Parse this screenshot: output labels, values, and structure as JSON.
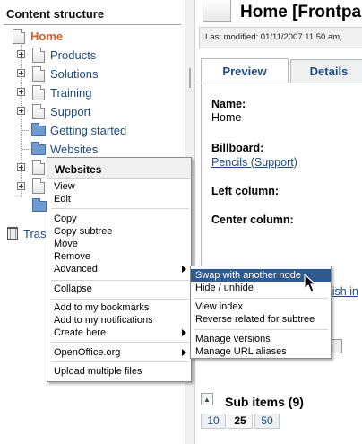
{
  "left_panel": {
    "title": "Content structure",
    "tree": [
      {
        "label": "Home",
        "kind": "page",
        "expandable": false,
        "root": true
      },
      {
        "label": "Products",
        "kind": "page",
        "expandable": true
      },
      {
        "label": "Solutions",
        "kind": "page",
        "expandable": true
      },
      {
        "label": "Training",
        "kind": "page",
        "expandable": true
      },
      {
        "label": "Support",
        "kind": "page",
        "expandable": true
      },
      {
        "label": "Getting started",
        "kind": "folder",
        "expandable": false
      },
      {
        "label": "Websites",
        "kind": "folder",
        "expandable": false
      }
    ],
    "trash_label": "Tras"
  },
  "right_panel": {
    "node_title": "Home [Frontpag",
    "last_modified": "Last modified: 01/11/2007 11:50 am,",
    "tabs": [
      {
        "label": "Preview",
        "active": true
      },
      {
        "label": "Details",
        "active": false
      }
    ],
    "fields": {
      "name_label": "Name:",
      "name_value": "Home",
      "billboard_label": "Billboard:",
      "billboard_value": "Pencils (Support)",
      "left_column_label": "Left column:",
      "center_column_label": "Center column:"
    },
    "partial_link": "lish in",
    "sub_items_label": "Sub items (9)",
    "pager": [
      "10",
      "25",
      "50"
    ],
    "pager_current": "25"
  },
  "context_menu": {
    "header": "Websites",
    "groups": [
      [
        "View",
        "Edit"
      ],
      [
        "Copy",
        "Copy subtree",
        "Move",
        "Remove",
        "Advanced"
      ],
      [
        "Collapse"
      ],
      [
        "Add to my bookmarks",
        "Add to my notifications",
        "Create here"
      ],
      [
        "OpenOffice.org"
      ],
      [
        "Upload multiple files"
      ]
    ],
    "has_submenu": [
      "Advanced",
      "Create here",
      "OpenOffice.org"
    ]
  },
  "submenu": {
    "groups": [
      [
        "Swap with another node",
        "Hide / unhide"
      ],
      [
        "View index",
        "Reverse related for subtree"
      ],
      [
        "Manage versions",
        "Manage URL aliases"
      ]
    ],
    "highlighted": "Swap with another node"
  },
  "colors": {
    "link": "#1c4a82",
    "root_node": "#e0571f",
    "menu_highlight": "#2e5a8f"
  }
}
